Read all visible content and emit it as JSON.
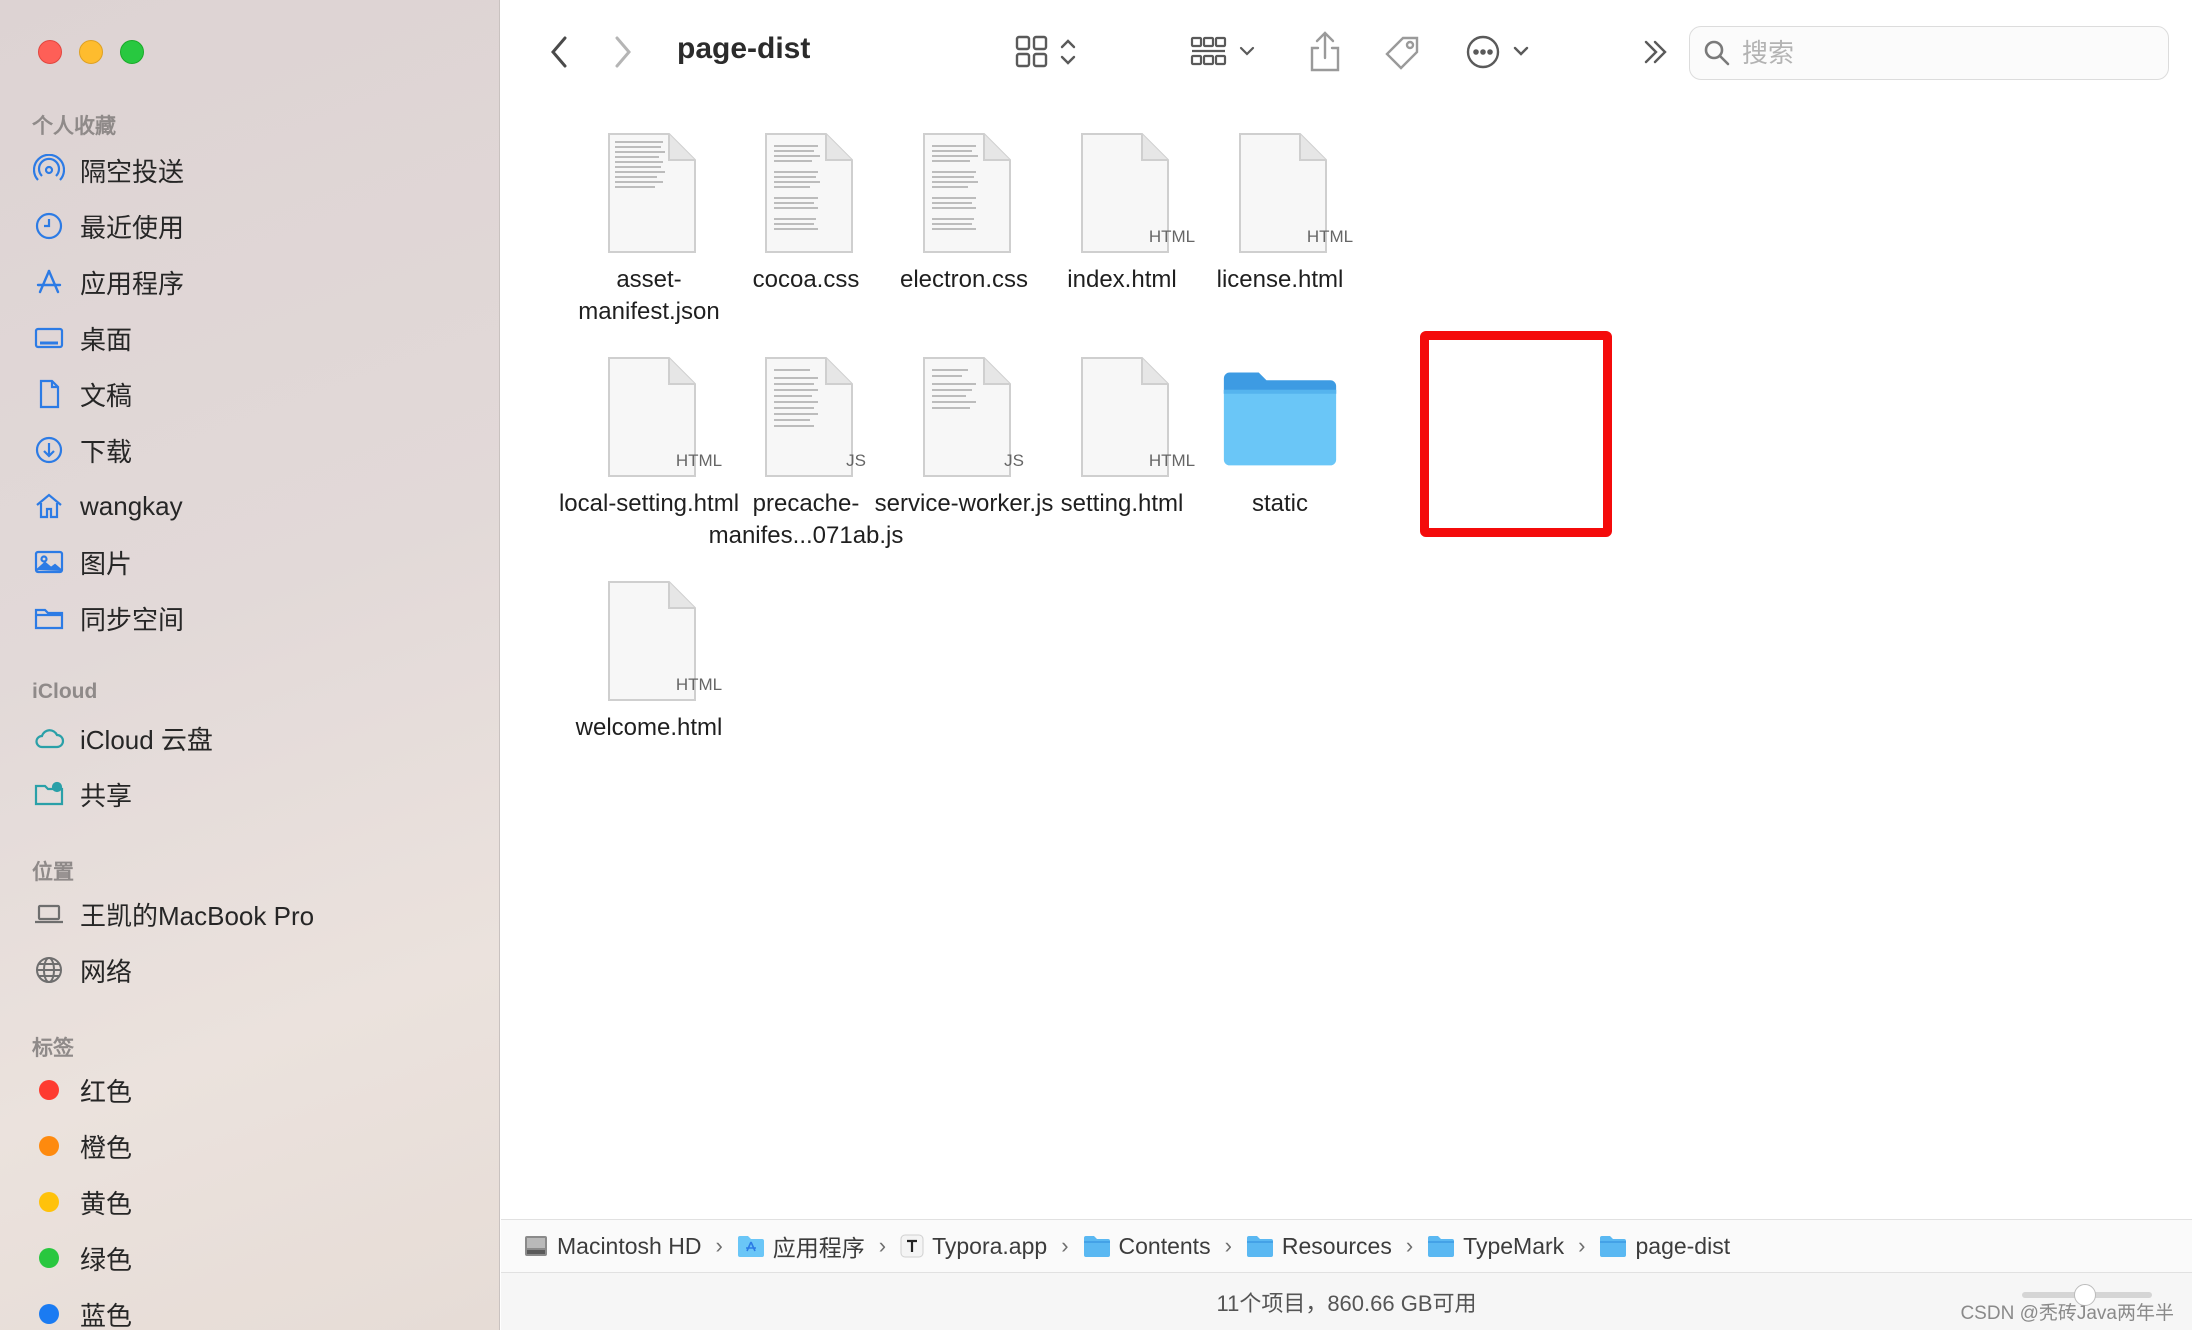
{
  "window": {
    "title": "page-dist"
  },
  "sidebar": {
    "favorites_heading": "个人收藏",
    "favorites": [
      {
        "label": "隔空投送",
        "icon": "airdrop-icon"
      },
      {
        "label": "最近使用",
        "icon": "clock-icon"
      },
      {
        "label": "应用程序",
        "icon": "applications-icon"
      },
      {
        "label": "桌面",
        "icon": "desktop-icon"
      },
      {
        "label": "文稿",
        "icon": "document-icon"
      },
      {
        "label": "下载",
        "icon": "download-icon"
      },
      {
        "label": "wangkay",
        "icon": "home-icon"
      },
      {
        "label": "图片",
        "icon": "photo-icon"
      },
      {
        "label": "同步空间",
        "icon": "folder-icon"
      }
    ],
    "icloud_heading": "iCloud",
    "icloud": [
      {
        "label": "iCloud 云盘",
        "icon": "cloud-icon"
      },
      {
        "label": "共享",
        "icon": "shared-folder-icon"
      }
    ],
    "locations_heading": "位置",
    "locations": [
      {
        "label": "王凯的MacBook Pro",
        "icon": "laptop-icon"
      },
      {
        "label": "网络",
        "icon": "globe-icon"
      }
    ],
    "tags_heading": "标签",
    "tags": [
      {
        "label": "红色",
        "color": "#fe3b30"
      },
      {
        "label": "橙色",
        "color": "#fe8a0e"
      },
      {
        "label": "黄色",
        "color": "#ffc20a"
      },
      {
        "label": "绿色",
        "color": "#29c73f"
      },
      {
        "label": "蓝色",
        "color": "#1a7bf2"
      }
    ]
  },
  "search": {
    "placeholder": "搜索"
  },
  "files": [
    {
      "name": "asset-\nmanifest.json",
      "kind": "text-doc",
      "badge": ""
    },
    {
      "name": "cocoa.css",
      "kind": "text-doc",
      "badge": ""
    },
    {
      "name": "electron.css",
      "kind": "text-doc",
      "badge": ""
    },
    {
      "name": "index.html",
      "kind": "doc",
      "badge": "HTML"
    },
    {
      "name": "license.html",
      "kind": "doc",
      "badge": "HTML"
    },
    {
      "name": "local-setting.html",
      "kind": "doc",
      "badge": "HTML"
    },
    {
      "name": "precache-\nmanifes...071ab.js",
      "kind": "text-doc",
      "badge": "JS"
    },
    {
      "name": "service-worker.js",
      "kind": "text-doc",
      "badge": "JS"
    },
    {
      "name": "setting.html",
      "kind": "doc",
      "badge": "HTML"
    },
    {
      "name": "static",
      "kind": "folder",
      "badge": ""
    },
    {
      "name": "welcome.html",
      "kind": "doc",
      "badge": "HTML"
    }
  ],
  "pathbar": [
    {
      "label": "Macintosh HD",
      "icon": "disk-icon"
    },
    {
      "label": "应用程序",
      "icon": "applications-folder-icon"
    },
    {
      "label": "Typora.app",
      "icon": "typora-app-icon"
    },
    {
      "label": "Contents",
      "icon": "folder-icon"
    },
    {
      "label": "Resources",
      "icon": "folder-icon"
    },
    {
      "label": "TypeMark",
      "icon": "folder-icon"
    },
    {
      "label": "page-dist",
      "icon": "folder-icon"
    }
  ],
  "status": {
    "text": "11个项目，860.66 GB可用"
  },
  "watermark": "CSDN @秃砖Java两年半"
}
